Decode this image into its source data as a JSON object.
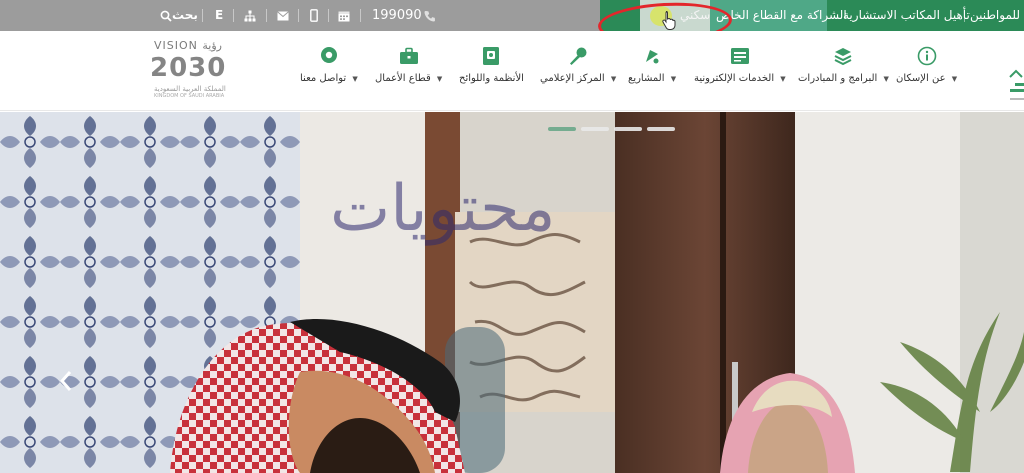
{
  "topbar": {
    "items": [
      {
        "label": "للمواطنين"
      },
      {
        "label": "تأهيل المكاتب الاستشارية"
      },
      {
        "label": "الشراكة مع القطاع الخاص"
      },
      {
        "label": "سكني"
      }
    ],
    "phone": "199090",
    "language": "E",
    "search_label": "بحث",
    "icons": [
      "phone-icon",
      "calendar-icon",
      "mobile-icon",
      "mail-icon",
      "sitemap-icon",
      "language-icon",
      "search-icon"
    ]
  },
  "logo": {
    "vision_top": "VISION رؤية",
    "vision_year": "2030",
    "vision_ar": "المملكة العربية السعودية",
    "vision_en": "KINGDOM OF SAUDI ARABIA"
  },
  "nav": {
    "items": [
      {
        "label": "تواصل معنا",
        "icon": "chat-icon"
      },
      {
        "label": "قطاع الأعمال",
        "icon": "briefcase-icon"
      },
      {
        "label": "الأنظمة واللوائح",
        "icon": "book-icon"
      },
      {
        "label": "المركز الإعلامي",
        "icon": "microphone-icon"
      },
      {
        "label": "المشاريع",
        "icon": "bell-icon"
      },
      {
        "label": "الخدمات الإلكترونية",
        "icon": "id-card-icon"
      },
      {
        "label": "البرامج و المبادرات",
        "icon": "layers-icon"
      },
      {
        "label": "عن الإسكان",
        "icon": "info-icon"
      }
    ]
  },
  "hero": {
    "watermark": "محتويات",
    "slides": 4,
    "active_slide": 1
  },
  "colors": {
    "brand_green": "#2b8a57",
    "accent": "#4fa887",
    "annotation_red": "#e3262b"
  }
}
